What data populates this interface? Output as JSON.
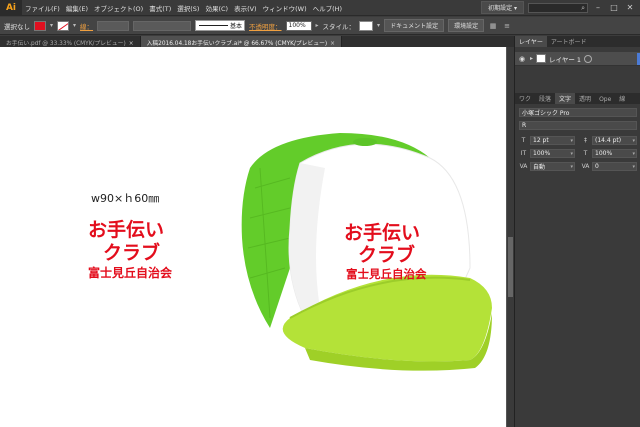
{
  "app": {
    "logo": "Ai"
  },
  "menu": {
    "items": [
      "ファイル(F)",
      "編集(E)",
      "オブジェクト(O)",
      "書式(T)",
      "選択(S)",
      "効果(C)",
      "表示(V)",
      "ウィンドウ(W)",
      "ヘルプ(H)"
    ],
    "workspace": "初期設定 ▾",
    "window_controls": [
      "–",
      "□",
      "✕"
    ]
  },
  "control": {
    "selection": "選択なし",
    "stroke_label": "線：",
    "brush_value": "基本",
    "opacity_label": "不透明度：",
    "opacity_value": "100%",
    "style_label": "スタイル：",
    "doc_setup": "ドキュメント設定",
    "prefs": "環境設定",
    "colors": {
      "fill": "#e01020",
      "accent": "#f7a21b",
      "opacity_label": "#f0a040"
    }
  },
  "tabs": [
    {
      "label": "お手伝い.pdf @ 33.33% (CMYK/プレビュー)",
      "active": false
    },
    {
      "label": "入稿2016.04.18お手伝いクラブ.ai* @ 66.67% (CMYK/プレビュー)",
      "active": true
    }
  ],
  "artboard": {
    "dimension": "w90×ｈ60㎜",
    "logo": {
      "line1": "お手伝い",
      "line2": "クラブ",
      "line3": "富士見丘自治会"
    },
    "cap_text": {
      "line1": "お手伝い",
      "line2": "クラブ",
      "line3": "富士見丘自治会"
    },
    "colors": {
      "text": "#e30d1c",
      "cap_mesh": "#6bd22a",
      "cap_brim": "#b6e43a",
      "cap_front": "#ffffff"
    }
  },
  "layers_panel": {
    "tabs": [
      "レイヤー",
      "アートボード"
    ],
    "layer_name": "レイヤー 1"
  },
  "char_panel": {
    "tabs": [
      "ワク",
      "段落",
      "文字",
      "透明",
      "Ope",
      "線"
    ],
    "font": "小塚ゴシック Pro",
    "style": "R",
    "size": "12 pt",
    "leading": "(14.4 pt)",
    "h_scale": "100%",
    "v_scale": "100%",
    "kerning": "自動",
    "tracking": "0"
  }
}
